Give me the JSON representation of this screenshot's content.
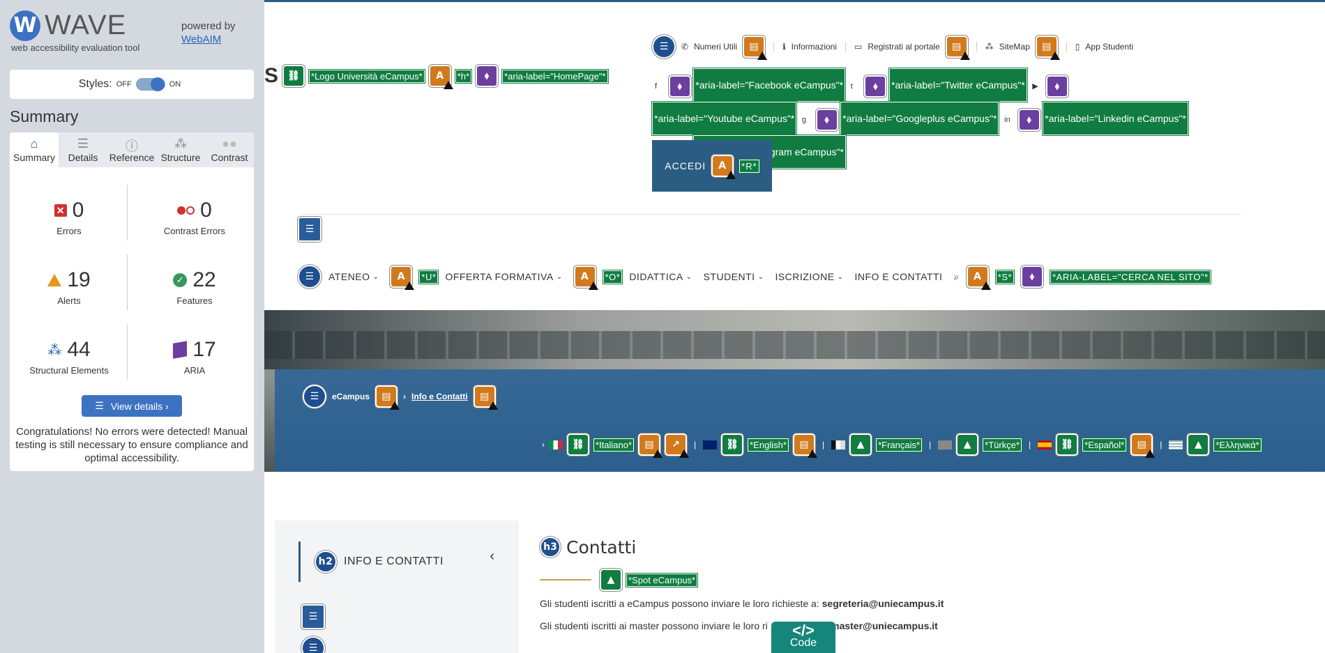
{
  "wave": {
    "logo_letter": "W",
    "logo_text": "WAVE",
    "subtitle": "web accessibility evaluation tool",
    "powered_by": "powered by",
    "webaim": "WebAIM",
    "styles_label": "Styles:",
    "styles_off": "OFF",
    "styles_on": "ON",
    "summary_title": "Summary",
    "tabs": [
      {
        "label": "Summary",
        "icon": "home-icon"
      },
      {
        "label": "Details",
        "icon": "list-icon"
      },
      {
        "label": "Reference",
        "icon": "info-icon"
      },
      {
        "label": "Structure",
        "icon": "structure-icon"
      },
      {
        "label": "Contrast",
        "icon": "contrast-icon"
      }
    ],
    "stats": {
      "errors": {
        "count": "0",
        "label": "Errors"
      },
      "contrast_errors": {
        "count": "0",
        "label": "Contrast Errors"
      },
      "alerts": {
        "count": "19",
        "label": "Alerts"
      },
      "features": {
        "count": "22",
        "label": "Features"
      },
      "structural": {
        "count": "44",
        "label": "Structural Elements"
      },
      "aria": {
        "count": "17",
        "label": "ARIA"
      }
    },
    "view_details": "View details ›",
    "congrats": "Congratulations! No errors were detected! Manual testing is still necessary to ensure compliance and optimal accessibility.",
    "colors": {
      "accent": "#3d72c2",
      "error": "#d0312d",
      "alert": "#e39a1a",
      "feature": "#38975c",
      "aria": "#6b3fa0"
    }
  },
  "site": {
    "logo_partial": "S",
    "logo_tags": [
      "*Logo Università eCampus*",
      "*h*",
      "*aria-label=\"HomePage\"*"
    ],
    "utility": [
      "Numeri Utili",
      "Informazioni",
      "Registrati al portale",
      "SiteMap",
      "App Studenti"
    ],
    "social_tags": [
      "*aria-label=\"Facebook eCampus\"*",
      "*aria-label=\"Twitter eCampus\"*",
      "*aria-label=\"Youtube eCampus\"*",
      "*aria-label=\"Googleplus eCampus\"*",
      "*aria-label=\"Linkedin eCampus\"*",
      "*aria-label=\"Instagram eCampus\"*"
    ],
    "accedi": "ACCEDI",
    "accedi_tag": "*R*",
    "nav": [
      {
        "label": "ATENEO",
        "tag": "*U*"
      },
      {
        "label": "OFFERTA FORMATIVA",
        "tag": "*O*"
      },
      {
        "label": "DIDATTICA",
        "tag": ""
      },
      {
        "label": "STUDENTI",
        "tag": ""
      },
      {
        "label": "ISCRIZIONE",
        "tag": ""
      },
      {
        "label": "INFO E CONTATTI",
        "tag": ""
      }
    ],
    "search_tag_s": "*S*",
    "search_tag_aria": "*ARIA-LABEL=\"CERCA NEL SITO\"*",
    "breadcrumb_home": "eCampus",
    "breadcrumb_current": "Info e Contatti",
    "languages": [
      "*Italiano*",
      "*English*",
      "*Français*",
      "*Türkçe*",
      "*Español*",
      "*Ελληνικά*"
    ],
    "sidebar_title": "INFO E CONTATTI",
    "h2_badge": "h2",
    "h3_badge": "h3",
    "contacts_title": "Contatti",
    "spot_tag": "*Spot eCampus*",
    "line1_text": "Gli studenti iscritti a eCampus possono inviare le loro richieste a: ",
    "line1_email": "segreteria@uniecampus.it",
    "line2_text": "Gli studenti iscritti ai master possono inviare le loro ri",
    "line2_email": "io.master@uniecampus.it",
    "code_symbol": "</>",
    "code_label": "Code"
  }
}
